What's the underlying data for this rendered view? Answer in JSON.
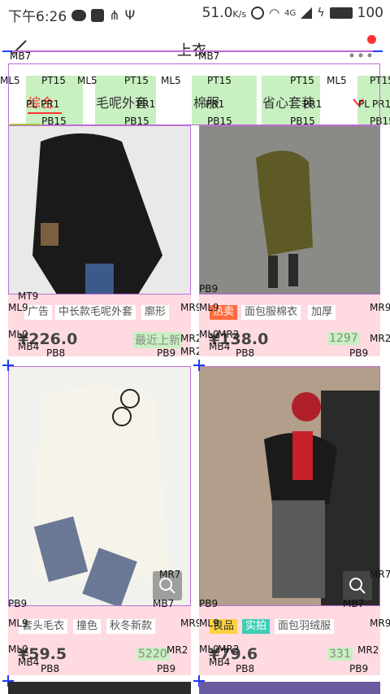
{
  "status": {
    "time": "下午6:26",
    "speed": "51.0",
    "speed_unit": "K/s",
    "network": "4G",
    "battery": "100"
  },
  "header": {
    "title": "上衣"
  },
  "tabs": [
    {
      "label": "综合"
    },
    {
      "label": "毛呢外套"
    },
    {
      "label": "棉服"
    },
    {
      "label": "省心套装"
    }
  ],
  "debug": {
    "mb7": "MB7",
    "ml5": "ML5",
    "pt15": "PT15",
    "pb15": "PB15",
    "pl": "PL",
    "pr1": "PR1",
    "mt9": "MT9",
    "ml9": "ML9",
    "mr9": "MR9",
    "mr2": "MR2",
    "mb4": "MB4",
    "pb8": "PB8",
    "pb9": "PB9",
    "mr7": "MR7",
    "ml0": "ML0"
  },
  "products": [
    {
      "tags": [
        "广告",
        "中长款毛呢外套",
        "廓形"
      ],
      "price": "¥226.0",
      "side": "最近上新"
    },
    {
      "tags_special": [
        {
          "text": "热卖",
          "kind": "hot"
        }
      ],
      "tags": [
        "面包服棉衣",
        "加厚"
      ],
      "price": "¥138.0",
      "side": "1297"
    },
    {
      "tags": [
        "套头毛衣",
        "撞色",
        "秋冬新款"
      ],
      "price": "¥59.5",
      "side": "5220"
    },
    {
      "tags_special": [
        {
          "text": "良品",
          "kind": "good"
        },
        {
          "text": "实拍",
          "kind": "real"
        }
      ],
      "tags": [
        "面包羽绒服"
      ],
      "price": "¥79.6",
      "side": "331"
    }
  ],
  "colors": {
    "tab_green": "#c8f0c0",
    "tag_pink": "#ffdbe1",
    "debug_purple": "#c06bd6",
    "debug_blue": "#1e3cff"
  }
}
